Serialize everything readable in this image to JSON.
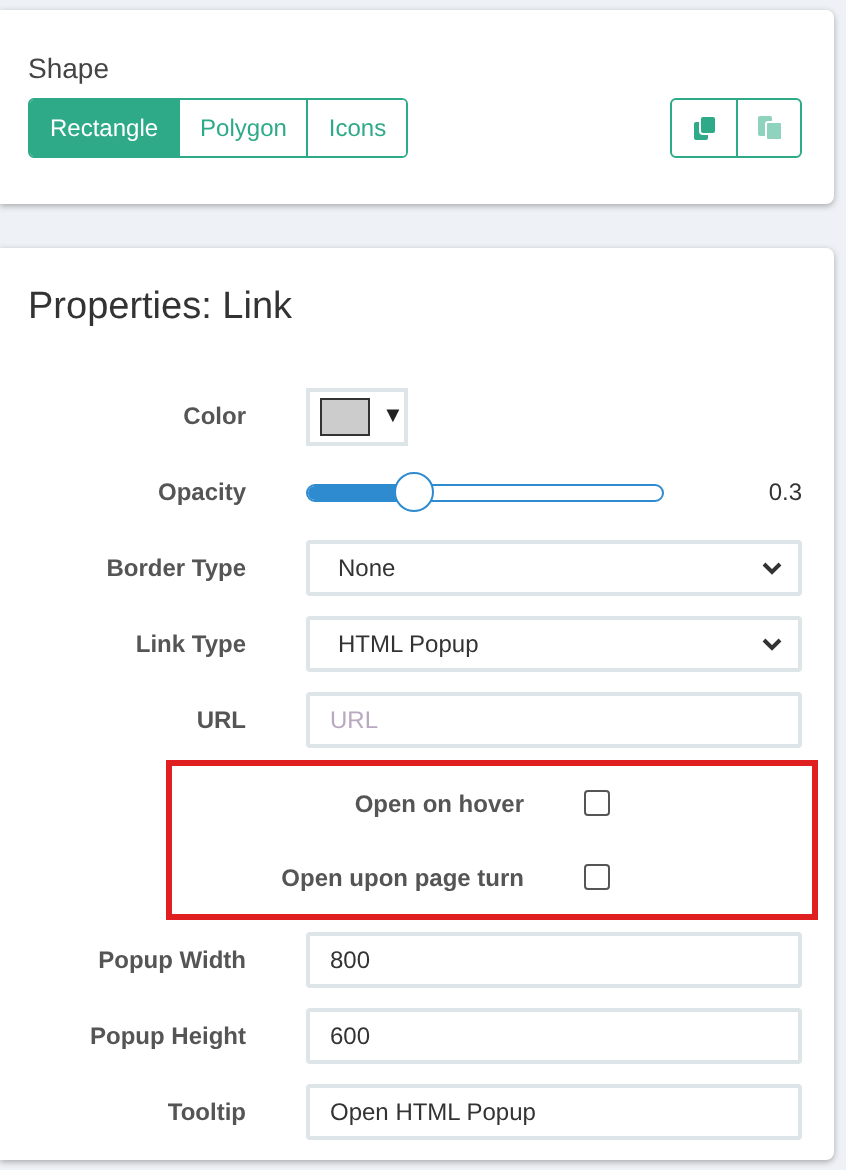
{
  "shape_panel": {
    "title": "Shape",
    "tabs": [
      {
        "label": "Rectangle",
        "selected": true
      },
      {
        "label": "Polygon",
        "selected": false
      },
      {
        "label": "Icons",
        "selected": false
      }
    ],
    "icon_buttons": [
      {
        "kind": "copy",
        "disabled": false
      },
      {
        "kind": "paste",
        "disabled": true
      }
    ]
  },
  "properties_panel": {
    "title": "Properties: Link",
    "rows": [
      {
        "kind": "color",
        "label": "Color",
        "color": "#cccccc",
        "caret": "▼"
      },
      {
        "kind": "slider",
        "label": "Opacity",
        "level": 0.3,
        "reading": "0.3"
      },
      {
        "kind": "select",
        "label": "Border Type",
        "value": "None"
      },
      {
        "kind": "select",
        "label": "Link Type",
        "value": "HTML Popup"
      },
      {
        "kind": "input",
        "label": "URL",
        "placeholder": "URL"
      },
      {
        "kind": "checkbox",
        "label": "Open on hover",
        "checked": false,
        "highlighted": true
      },
      {
        "kind": "checkbox",
        "label": "Open upon page turn",
        "checked": false,
        "highlighted": true
      },
      {
        "kind": "input",
        "label": "Popup Width",
        "value": "800"
      },
      {
        "kind": "input",
        "label": "Popup Height",
        "value": "600"
      },
      {
        "kind": "input",
        "label": "Tooltip",
        "value": "Open HTML Popup"
      }
    ]
  }
}
